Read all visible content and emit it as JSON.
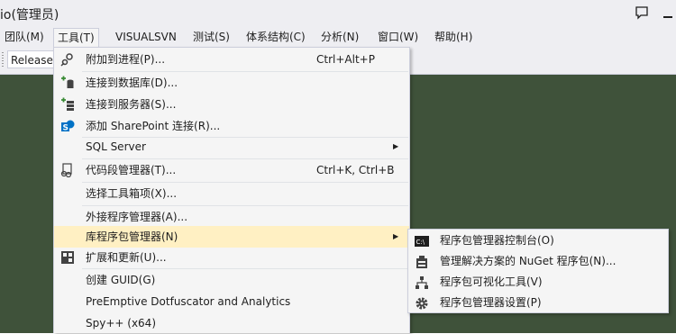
{
  "window": {
    "title": "io(管理员)"
  },
  "menubar": {
    "items": [
      "团队(M)",
      "工具(T)",
      "VISUALSVN",
      "测试(S)",
      "体系结构(C)",
      "分析(N)",
      "窗口(W)",
      "帮助(H)"
    ]
  },
  "toolbar": {
    "configuration": "Release"
  },
  "tools_menu": {
    "attach": {
      "label": "附加到进程(P)...",
      "shortcut": "Ctrl+Alt+P"
    },
    "connect_db": {
      "label": "连接到数据库(D)..."
    },
    "connect_server": {
      "label": "连接到服务器(S)..."
    },
    "sharepoint": {
      "label": "添加 SharePoint 连接(R)..."
    },
    "sql_server": {
      "label": "SQL Server"
    },
    "snippets": {
      "label": "代码段管理器(T)...",
      "shortcut": "Ctrl+K, Ctrl+B"
    },
    "toolbox": {
      "label": "选择工具箱项(X)..."
    },
    "external": {
      "label": "外接程序管理器(A)..."
    },
    "nuget": {
      "label": "库程序包管理器(N)"
    },
    "extensions": {
      "label": "扩展和更新(U)..."
    },
    "guid": {
      "label": "创建 GUID(G)"
    },
    "preemptive": {
      "label": "PreEmptive Dotfuscator and Analytics"
    },
    "spy": {
      "label": "Spy++ (x64)"
    }
  },
  "nuget_submenu": {
    "console": "程序包管理器控制台(O)",
    "manage": "管理解决方案的 NuGet 程序包(N)...",
    "visualizer": "程序包可视化工具(V)",
    "settings": "程序包管理器设置(P)"
  },
  "colors": {
    "highlight": "#fff0c3",
    "menu_bg": "#f5f5f5",
    "editor_bg": "#3f523a"
  }
}
